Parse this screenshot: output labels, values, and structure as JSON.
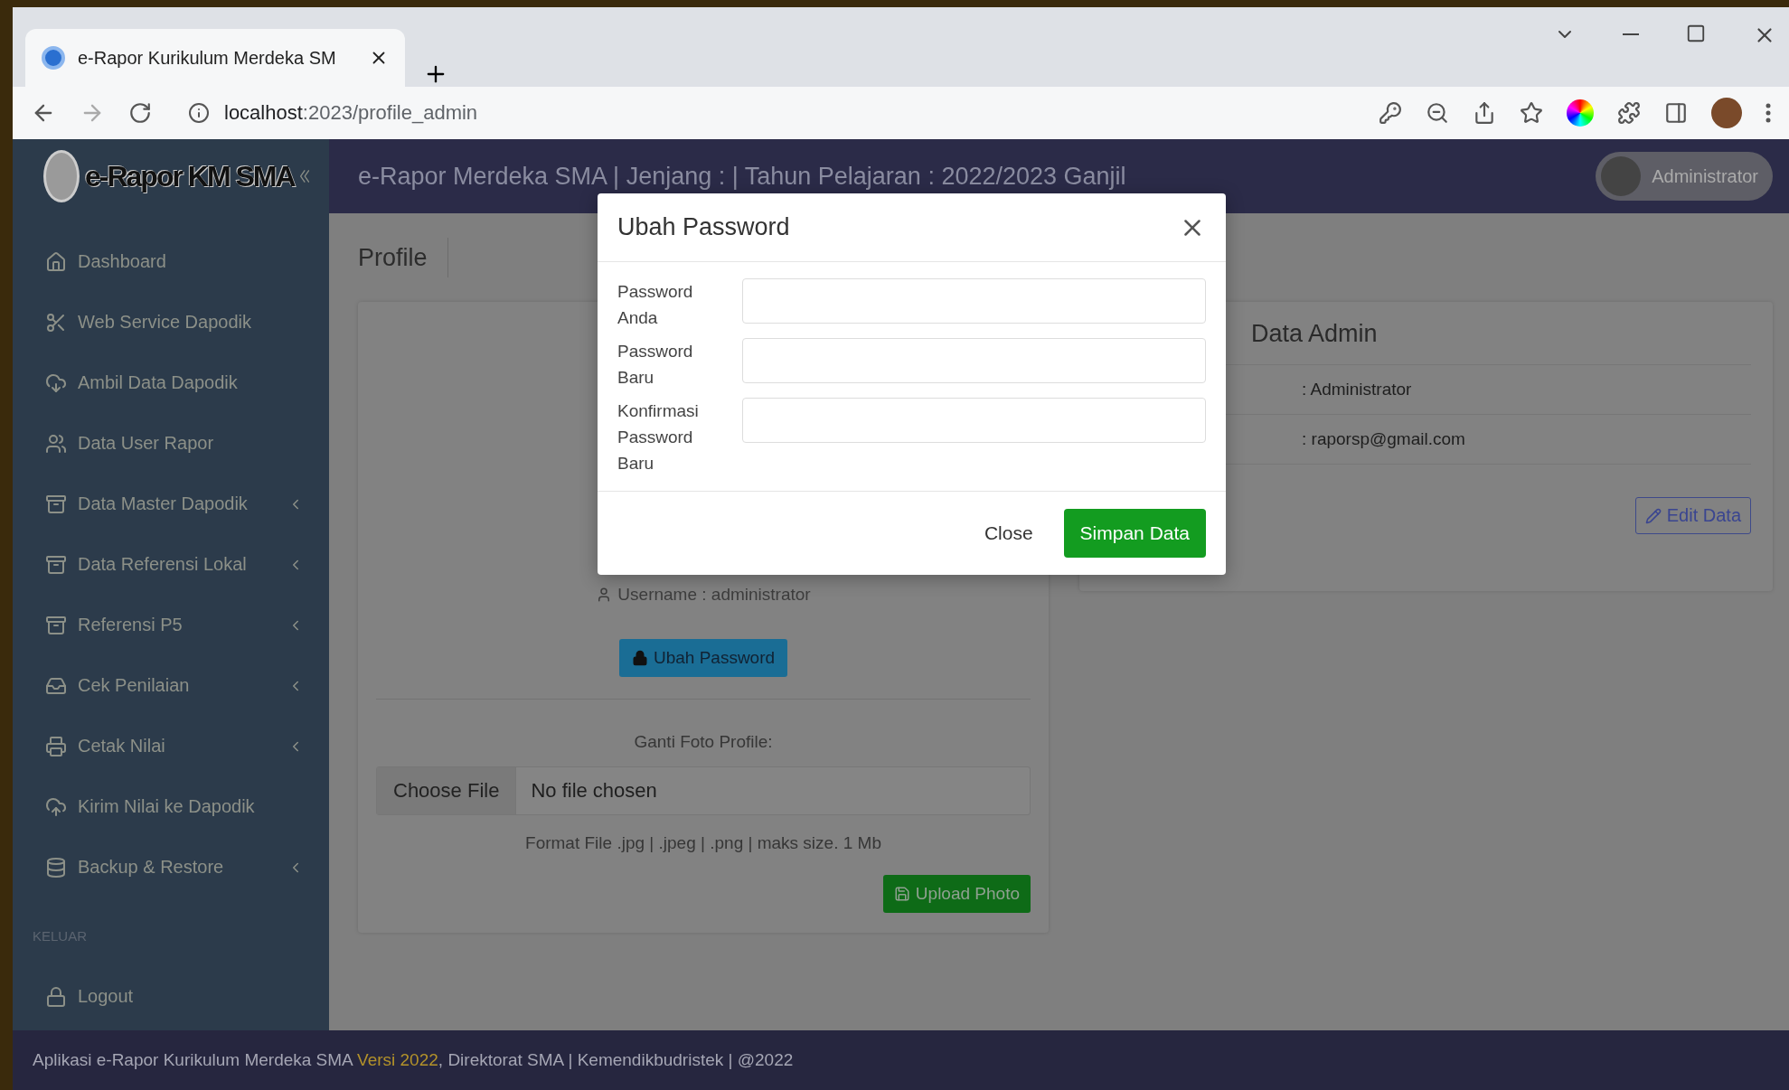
{
  "browser": {
    "tab_title": "e-Rapor Kurikulum Merdeka SM",
    "url_host": "localhost",
    "url_path": ":2023/profile_admin"
  },
  "app": {
    "logo": "e-Rapor KM SMA",
    "header_title": "e-Rapor Merdeka SMA | Jenjang : | Tahun Pelajaran : 2022/2023 Ganjil",
    "user": "Administrator"
  },
  "sidebar": {
    "items": [
      {
        "label": "Dashboard",
        "expandable": false
      },
      {
        "label": "Web Service Dapodik",
        "expandable": false
      },
      {
        "label": "Ambil Data Dapodik",
        "expandable": false
      },
      {
        "label": "Data User Rapor",
        "expandable": false
      },
      {
        "label": "Data Master Dapodik",
        "expandable": true
      },
      {
        "label": "Data Referensi Lokal",
        "expandable": true
      },
      {
        "label": "Referensi P5",
        "expandable": true
      },
      {
        "label": "Cek Penilaian",
        "expandable": true
      },
      {
        "label": "Cetak Nilai",
        "expandable": true
      },
      {
        "label": "Kirim Nilai ke Dapodik",
        "expandable": false
      },
      {
        "label": "Backup & Restore",
        "expandable": true
      }
    ],
    "section": "KELUAR",
    "logout": "Logout"
  },
  "page_title": "Profile",
  "profile_card": {
    "username": "Username : administrator",
    "change_password_button": "Ubah Password",
    "photo_label": "Ganti Foto Profile:",
    "file_button": "Choose File",
    "file_status": "No file chosen",
    "format_note": "Format File .jpg | .jpeg | .png | maks size. 1 Mb",
    "upload_button": "Upload Photo"
  },
  "admin_card": {
    "title": "Data Admin",
    "rows": [
      {
        "value": ": Administrator"
      },
      {
        "value": ": raporsp@gmail.com"
      }
    ],
    "edit_button": "Edit Data"
  },
  "modal": {
    "title": "Ubah Password",
    "fields": [
      {
        "label": "Password Anda"
      },
      {
        "label": "Password Baru"
      },
      {
        "label": "Konfirmasi Password Baru"
      }
    ],
    "close_button": "Close",
    "save_button": "Simpan Data"
  },
  "footer": {
    "text": "Aplikasi e-Rapor Kurikulum Merdeka SMA",
    "version": "Versi 2022",
    "rest": ", Direktorat SMA | Kemendikbudristek | @2022"
  }
}
